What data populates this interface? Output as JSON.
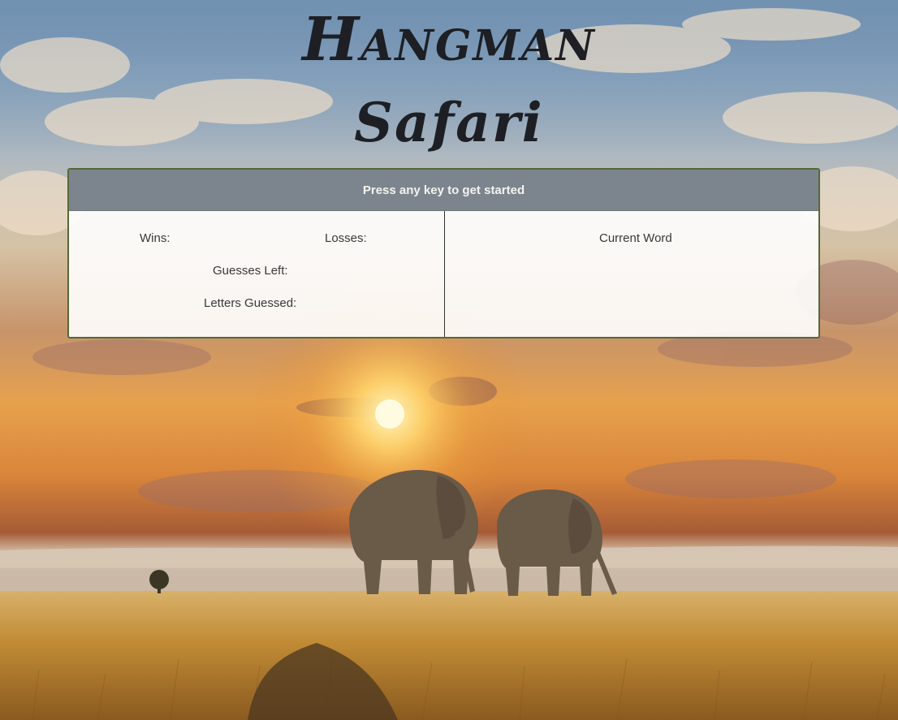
{
  "header": {
    "title": "Hangman",
    "subtitle": "Safari"
  },
  "panel": {
    "prompt": "Press any key to get started",
    "wins_label": "Wins:",
    "losses_label": "Losses:",
    "guesses_left_label": "Guesses Left:",
    "letters_guessed_label": "Letters Guessed:",
    "current_word_label": "Current Word"
  },
  "colors": {
    "title_text": "#1d1f24",
    "panel_header_bg": "#788189",
    "panel_border": "#55683a",
    "panel_body_bg": "#ffffff"
  }
}
